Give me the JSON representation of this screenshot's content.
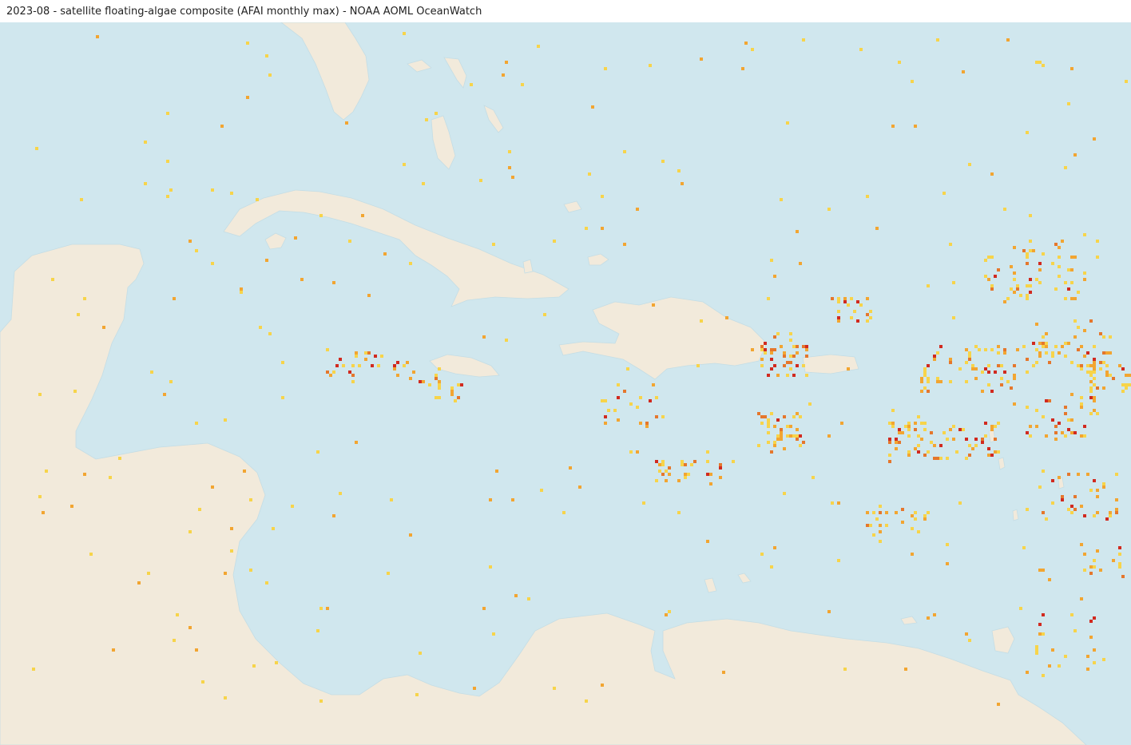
{
  "title": "2023-08 - satellite floating-algae composite (AFAI monthly max) - NOAA AOML OceanWatch",
  "colors": {
    "ocean": "#d0e7ee",
    "land": "#f2eadb",
    "coast": "#c4dde5",
    "algae_low": "#f7d44a",
    "algae_mid": "#f2a531",
    "algae_high": "#e5772c",
    "algae_max": "#d12a1f"
  },
  "layers": [
    "ocean",
    "land",
    "floating-algae-pixels"
  ]
}
